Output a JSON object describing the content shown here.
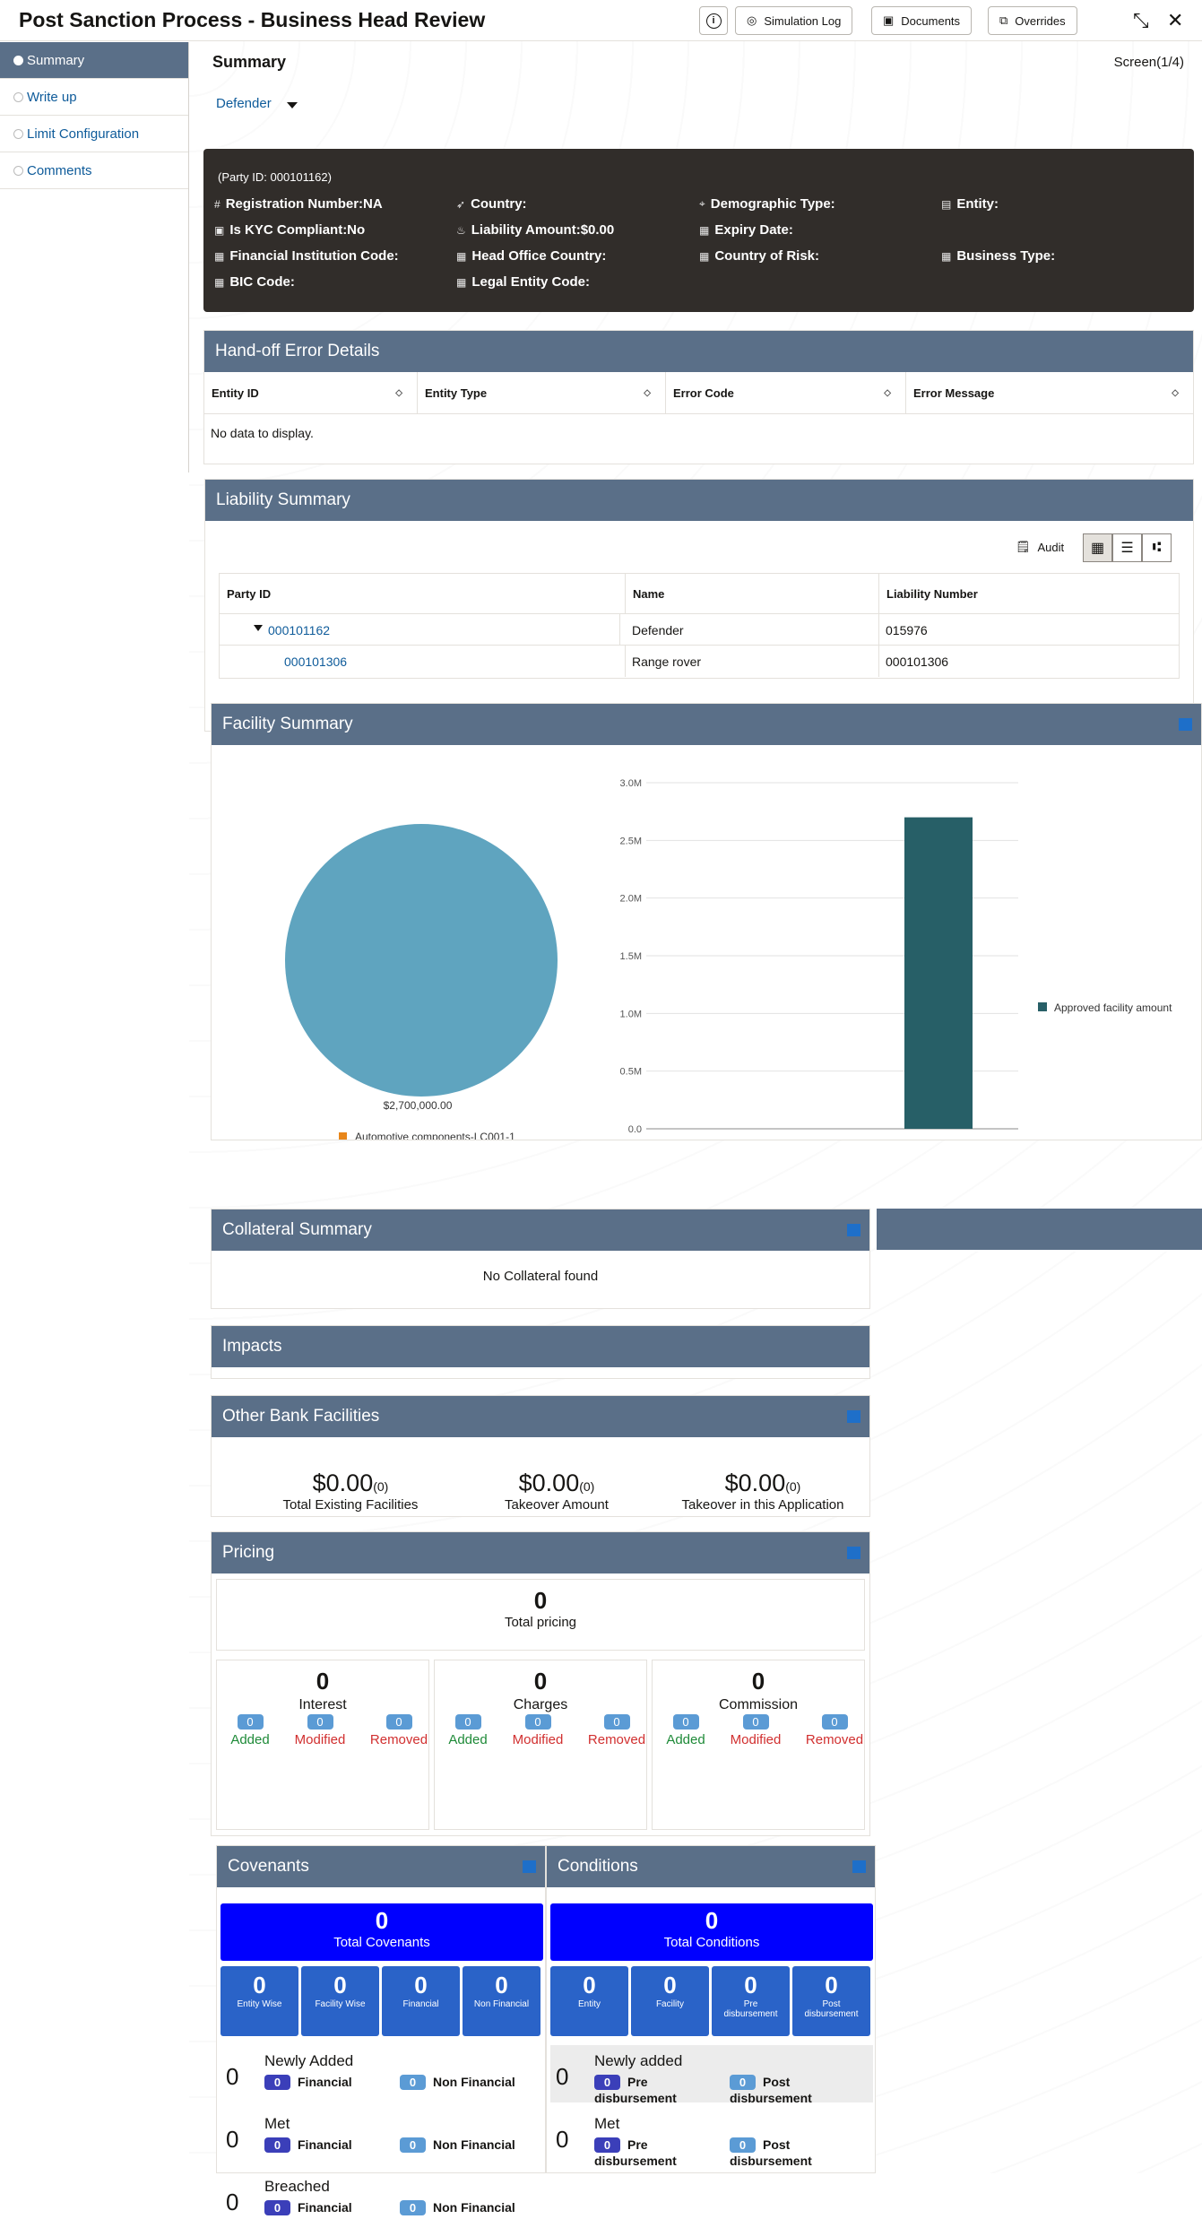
{
  "header": {
    "title": "Post Sanction Process - Business Head Review",
    "buttons": {
      "info": "i",
      "simulation_log": "Simulation Log",
      "documents": "Documents",
      "overrides": "Overrides"
    }
  },
  "sidebar": {
    "items": [
      {
        "label": "Summary"
      },
      {
        "label": "Write up"
      },
      {
        "label": "Limit Configuration"
      },
      {
        "label": "Comments"
      }
    ]
  },
  "main": {
    "title": "Summary",
    "screen": "Screen(1/4)",
    "selector": "Defender"
  },
  "party": {
    "id": "(Party ID: 000101162)",
    "fields": {
      "reg": "Registration Number:NA",
      "country": "Country:",
      "demo": "Demographic Type:",
      "entity": "Entity:",
      "kyc": "Is KYC Compliant:No",
      "liability": "Liability Amount:$0.00",
      "expiry": "Expiry Date:",
      "fic": "Financial Institution Code:",
      "hoc": "Head Office Country:",
      "cor": "Country of Risk:",
      "btype": "Business Type:",
      "bic": "BIC Code:",
      "lec": "Legal Entity Code:"
    }
  },
  "handoff": {
    "title": "Hand-off Error Details",
    "columns": [
      "Entity ID",
      "Entity Type",
      "Error Code",
      "Error Message"
    ],
    "empty": "No data to display."
  },
  "liability": {
    "title": "Liability Summary",
    "audit": "Audit",
    "columns": [
      "Party ID",
      "Name",
      "Liability Number"
    ],
    "rows": [
      [
        "000101162",
        "Defender",
        "015976"
      ],
      [
        "000101306",
        "Range rover",
        "000101306"
      ]
    ]
  },
  "facility": {
    "title": "Facility Summary",
    "chart_data": {
      "type": "bar",
      "categories": [
        "Automotive components"
      ],
      "series": [
        {
          "name": "Approved facility amount",
          "values": [
            2700000
          ]
        }
      ],
      "ylim": [
        0,
        3000000
      ],
      "yticks": [
        "0.0",
        "0.5M",
        "1.0M",
        "1.5M",
        "2.0M",
        "2.5M",
        "3.0M"
      ],
      "pie": {
        "label": "$2,700,000.00",
        "legend": "Automotive components-LC001-1",
        "values": [
          2700000
        ]
      },
      "colors": {
        "pie": "#5fa4bf",
        "bar": "#275f67",
        "legend_pie": "#e8861a"
      }
    }
  },
  "collateral": {
    "title": "Collateral Summary",
    "empty": "No Collateral found"
  },
  "impacts": {
    "title": "Impacts"
  },
  "other_bank": {
    "title": "Other Bank Facilities",
    "items": [
      {
        "value": "$0.00",
        "count": "(0)",
        "label": "Total Existing Facilities"
      },
      {
        "value": "$0.00",
        "count": "(0)",
        "label": "Takeover Amount"
      },
      {
        "value": "$0.00",
        "count": "(0)",
        "label": "Takeover in this Application"
      }
    ]
  },
  "pricing": {
    "title": "Pricing",
    "total": "0",
    "total_label": "Total pricing",
    "groups": [
      {
        "value": "0",
        "label": "Interest"
      },
      {
        "value": "0",
        "label": "Charges"
      },
      {
        "value": "0",
        "label": "Commission"
      }
    ],
    "sub": {
      "added": "Added",
      "modified": "Modified",
      "removed": "Removed",
      "zero": "0"
    }
  },
  "covenants": {
    "title": "Covenants",
    "total": "0",
    "total_label": "Total Covenants",
    "boxes": [
      {
        "v": "0",
        "l": "Entity Wise"
      },
      {
        "v": "0",
        "l": "Facility Wise"
      },
      {
        "v": "0",
        "l": "Financial"
      },
      {
        "v": "0",
        "l": "Non Financial"
      }
    ],
    "rows": [
      {
        "count": "0",
        "title": "Newly Added",
        "a": "Financial",
        "b": "Non Financial",
        "pa": "0",
        "pb": "0"
      },
      {
        "count": "0",
        "title": "Met",
        "a": "Financial",
        "b": "Non Financial",
        "pa": "0",
        "pb": "0"
      },
      {
        "count": "0",
        "title": "Breached",
        "a": "Financial",
        "b": "Non Financial",
        "pa": "0",
        "pb": "0"
      }
    ]
  },
  "conditions": {
    "title": "Conditions",
    "total": "0",
    "total_label": "Total Conditions",
    "boxes": [
      {
        "v": "0",
        "l": "Entity"
      },
      {
        "v": "0",
        "l": "Facility"
      },
      {
        "v": "0",
        "l": "Pre disbursement"
      },
      {
        "v": "0",
        "l": "Post disbursement"
      }
    ],
    "rows": [
      {
        "count": "0",
        "title": "Newly added",
        "a": "Pre disbursement",
        "b": "Post disbursement",
        "pa": "0",
        "pb": "0"
      },
      {
        "count": "0",
        "title": "Met",
        "a": "Pre disbursement",
        "b": "Post disbursement",
        "pa": "0",
        "pb": "0"
      }
    ]
  }
}
